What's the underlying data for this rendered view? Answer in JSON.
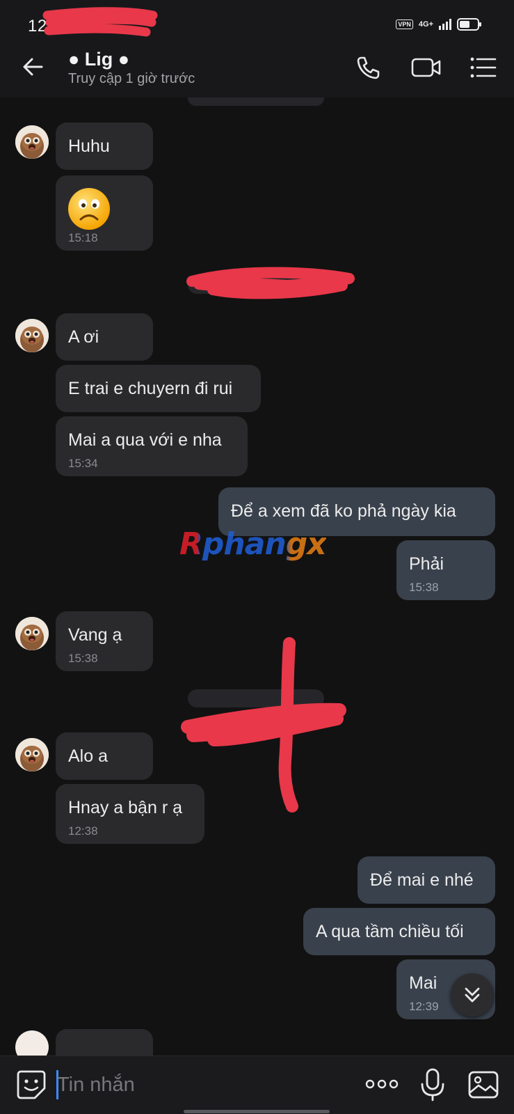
{
  "status_bar": {
    "time": "12:3",
    "vpn": "VPN",
    "network": "4G+"
  },
  "header": {
    "title": "● Lig ●",
    "subtitle": "Truy cập 1 giờ trước"
  },
  "messages": [
    {
      "text": "Huhu"
    },
    {
      "emoji": "frowning-face",
      "time": "15:18"
    },
    {
      "text": "A ơi"
    },
    {
      "text": "E trai e chuyern đi rui"
    },
    {
      "text": "Mai a qua với e nha",
      "time": "15:34"
    },
    {
      "text": "Để a xem đã ko phả ngày kia"
    },
    {
      "text": "Phải",
      "time": "15:38"
    },
    {
      "text": "Vang ạ",
      "time": "15:38"
    },
    {
      "text": "Alo a"
    },
    {
      "text": "Hnay a bận r ạ",
      "time": "12:38"
    },
    {
      "text": "Để mai e nhé"
    },
    {
      "text": "A qua tầm chiều tối"
    },
    {
      "text": "Mai",
      "time": "12:39"
    }
  ],
  "watermark": "Rphangx",
  "input": {
    "placeholder": "Tin nhắn"
  },
  "colors": {
    "background": "#121212",
    "incoming_bubble": "#2a2a2d",
    "outgoing_bubble": "#39414c",
    "redaction": "#e8384a",
    "caret": "#3b8cff"
  }
}
